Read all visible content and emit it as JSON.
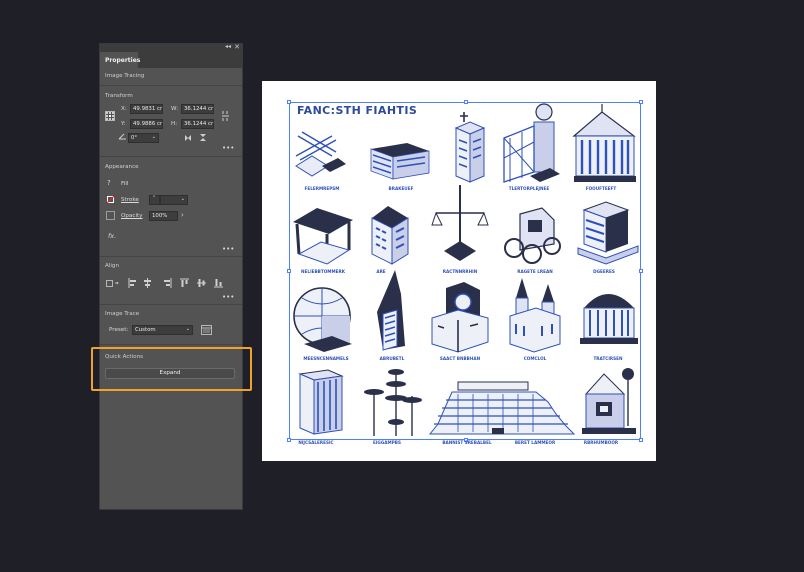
{
  "panel": {
    "tab": "Properties",
    "context_label": "Image Tracing",
    "transform": {
      "title": "Transform",
      "x_label": "X:",
      "x_value": "49.9831 cr",
      "y_label": "Y:",
      "y_value": "49.9886 cr",
      "w_label": "W:",
      "w_value": "36.1244 cr",
      "h_label": "H:",
      "h_value": "36.1244 cr",
      "rotation_value": "0°"
    },
    "appearance": {
      "title": "Appearance",
      "fill_label": "Fill",
      "stroke_label": "Stroke",
      "opacity_label": "Opacity",
      "opacity_value": "100%",
      "fx_label": "fx."
    },
    "align": {
      "title": "Align"
    },
    "image_trace": {
      "title": "Image Trace",
      "preset_label": "Preset:",
      "preset_value": "Custom"
    },
    "quick_actions": {
      "title": "Quick Actions",
      "expand_label": "Expand"
    },
    "more_glyph": "•••",
    "colors": {
      "highlight": "#f0a22a",
      "selection": "#4d7fff",
      "art_blue": "#2e51b9"
    }
  },
  "artboard": {
    "title": "FANC:STH FIAHTIS",
    "captions": [
      "FELERMREPSM",
      "BRAKEUEF",
      "",
      "TLERTORPLEJNEE",
      "FOOUFTEEFT",
      "NELIEBBTOMMERK",
      "ARE",
      "RACTNNRRHIN",
      "RAGETE LREAN",
      "DGEERES",
      "MEESNCENNAMELS",
      "ABRUBETL",
      "SAACT BNBBHAN",
      "COMCLOL",
      "TRATCIRSEN",
      "NIJCSALERESIC",
      "EIGGAMPBS",
      "BANNIST SREBALBEL",
      "BERET LAMMEOR",
      "RBRHUMBOOR"
    ]
  }
}
